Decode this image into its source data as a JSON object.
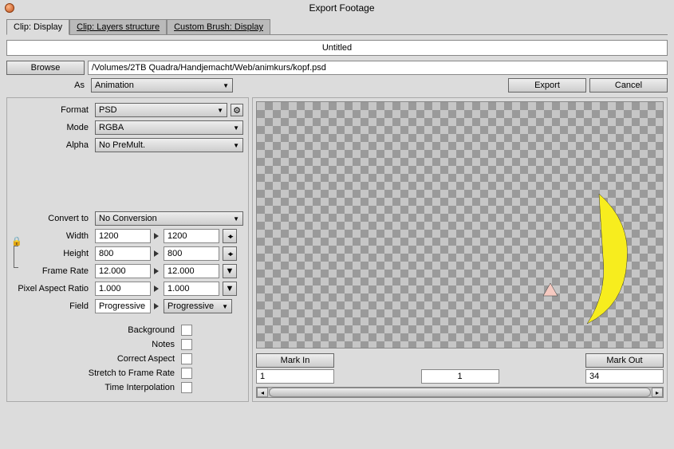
{
  "window": {
    "title": "Export Footage"
  },
  "tabs": {
    "t1": "Clip: Display",
    "t2": "Clip: Layers structure",
    "t3": "Custom Brush: Display"
  },
  "clip_title": "Untitled",
  "browse": {
    "button": "Browse",
    "path": "/Volumes/2TB Quadra/Handjemacht/Web/animkurs/kopf.psd"
  },
  "as": {
    "label": "As",
    "value": "Animation"
  },
  "buttons": {
    "export": "Export",
    "cancel": "Cancel",
    "mark_in": "Mark In",
    "mark_out": "Mark Out"
  },
  "format": {
    "label": "Format",
    "value": "PSD"
  },
  "mode": {
    "label": "Mode",
    "value": "RGBA"
  },
  "alpha": {
    "label": "Alpha",
    "value": "No PreMult."
  },
  "convert": {
    "label": "Convert to",
    "value": "No Conversion"
  },
  "width": {
    "label": "Width",
    "v1": "1200",
    "v2": "1200"
  },
  "height": {
    "label": "Height",
    "v1": "800",
    "v2": "800"
  },
  "framerate": {
    "label": "Frame Rate",
    "v1": "12.000",
    "v2": "12.000"
  },
  "par": {
    "label": "Pixel Aspect Ratio",
    "v1": "1.000",
    "v2": "1.000"
  },
  "field": {
    "label": "Field",
    "v1": "Progressive",
    "v2": "Progressive"
  },
  "checks": {
    "background": "Background",
    "notes": "Notes",
    "correct_aspect": "Correct Aspect",
    "stretch": "Stretch to Frame Rate",
    "time_interp": "Time Interpolation"
  },
  "range": {
    "start": "1",
    "current": "1",
    "end": "34"
  }
}
